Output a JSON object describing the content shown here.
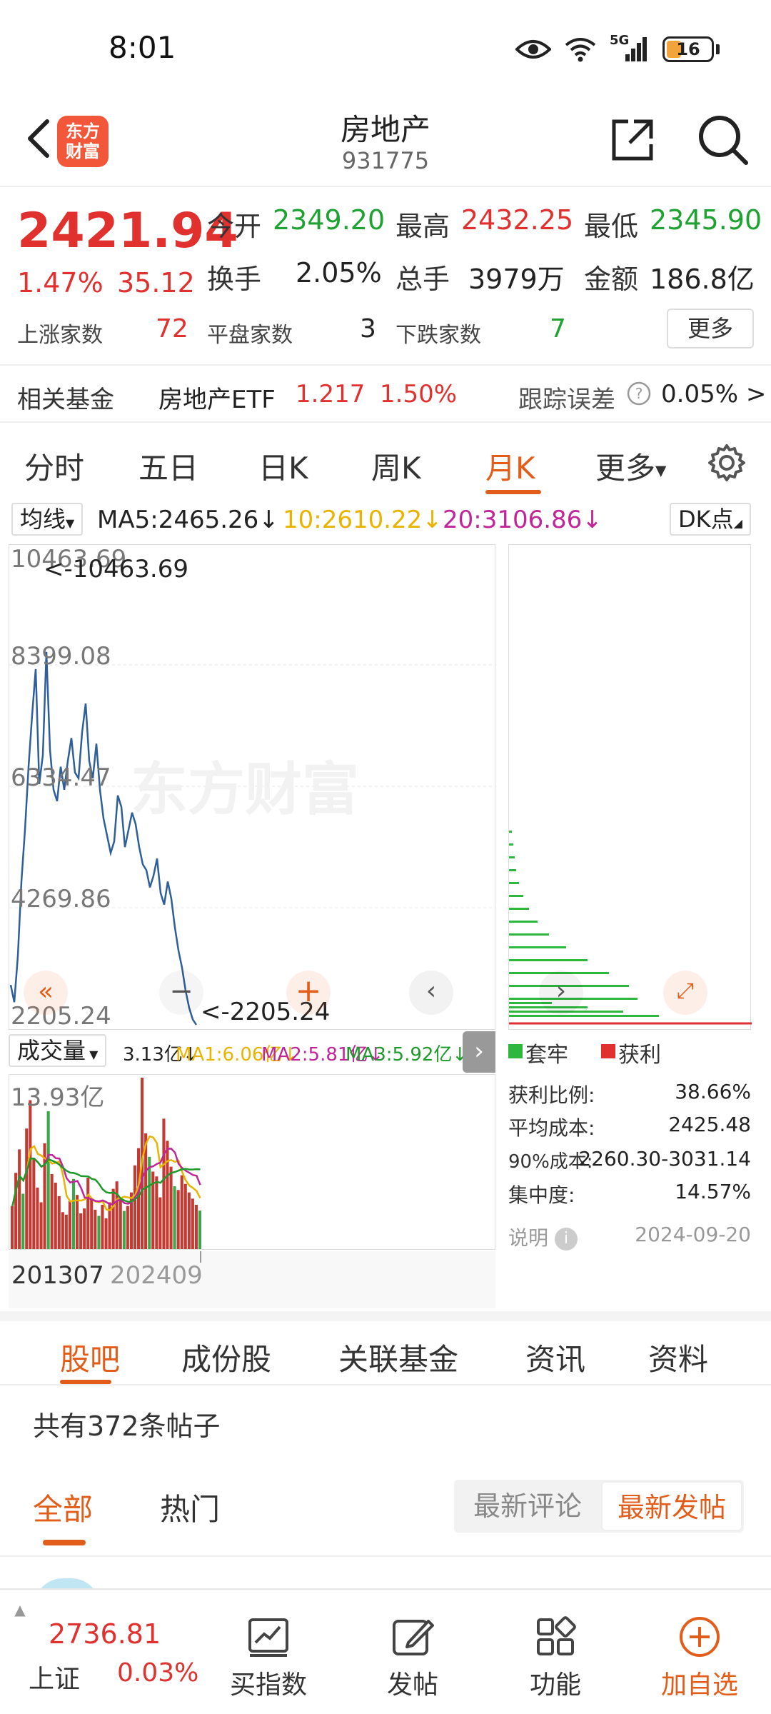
{
  "status_bar": {
    "time": "8:01",
    "network": "5G",
    "battery": "16"
  },
  "header": {
    "title": "房地产",
    "code": "931775",
    "logo_text": [
      "东方",
      "财富"
    ]
  },
  "quote": {
    "price": "2421.94",
    "change_pct": "1.47%",
    "change_val": "35.12",
    "open_label": "今开",
    "open": "2349.20",
    "high_label": "最高",
    "high": "2432.25",
    "low_label": "最低",
    "low": "2345.90",
    "turnover_label": "换手",
    "turnover": "2.05%",
    "volume_label": "总手",
    "volume": "3979万",
    "amount_label": "金额",
    "amount": "186.8亿",
    "up_label": "上涨家数",
    "up": "72",
    "flat_label": "平盘家数",
    "flat": "3",
    "down_label": "下跌家数",
    "down": "7",
    "more_label": "更多"
  },
  "fund": {
    "label": "相关基金",
    "name": "房地产ETF",
    "price": "1.217",
    "pct": "1.50%",
    "tracking_label": "跟踪误差",
    "tracking_value": "0.05% >"
  },
  "period_tabs": [
    "分时",
    "五日",
    "日K",
    "周K",
    "月K",
    "更多"
  ],
  "active_period": "月K",
  "ma": {
    "selector": "均线",
    "ma5": "MA5:2465.26↓",
    "ma10": "10:2610.22↓",
    "ma20": "20:3106.86↓",
    "dk_label": "DK点",
    "ma5_color": "#222222",
    "ma10_color": "#e8b400",
    "ma20_color": "#c0269a"
  },
  "chart": {
    "y_ticks": [
      "10463.69",
      "8399.08",
      "6334.47",
      "4269.86",
      "2205.24"
    ],
    "max_marker": "<-10463.69",
    "min_marker": "<-2205.24",
    "watermark": "东方财富",
    "line_color": "#2e5f9a",
    "monthly_close": [
      2900,
      2600,
      3400,
      4700,
      5600,
      6700,
      7600,
      8400,
      6400,
      6900,
      8700,
      7000,
      6300,
      6100,
      6700,
      6300,
      6800,
      7200,
      6600,
      6500,
      7300,
      7800,
      6800,
      6500,
      7100,
      6300,
      5800,
      5500,
      5200,
      5400,
      6200,
      6000,
      5300,
      5600,
      5900,
      5700,
      5300,
      5000,
      4900,
      4600,
      4800,
      5100,
      4500,
      4300,
      4700,
      4400,
      3900,
      3500,
      3200,
      2800,
      2500,
      2300,
      2205
    ]
  },
  "volume": {
    "selector": "成交量",
    "vol": "3.13亿↓",
    "ma1": "MA1:6.06亿↓",
    "ma2": "MA2:5.81亿↓",
    "ma3": "MA3:5.92亿↓",
    "max_label": "13.93亿",
    "ma1_color": "#e8b400",
    "ma2_color": "#c0269a",
    "ma3_color": "#1e9a2a",
    "bars": [
      3.5,
      6.2,
      8.1,
      4.5,
      9.8,
      12.1,
      7.3,
      5.0,
      3.8,
      8.6,
      11.2,
      6.1,
      5.4,
      4.3,
      3.0,
      2.8,
      3.9,
      5.7,
      4.4,
      2.9,
      3.3,
      5.8,
      4.1,
      3.2,
      2.7,
      3.6,
      2.5,
      3.8,
      4.9,
      5.5,
      4.0,
      3.1,
      3.5,
      4.6,
      6.8,
      8.2,
      13.93,
      9.4,
      7.5,
      6.3,
      5.9,
      4.2,
      10.6,
      8.8,
      6.7,
      5.1,
      4.8,
      6.0,
      5.3,
      4.6,
      4.1,
      3.6,
      3.13
    ],
    "start_date": "201307",
    "end_date": "202409"
  },
  "chips": {
    "legend_trapped": "套牢",
    "legend_profit": "获利",
    "trapped_color": "#2db83d",
    "profit_color": "#e0312f",
    "profit_ratio_label": "获利比例:",
    "profit_ratio": "38.66%",
    "avg_cost_label": "平均成本:",
    "avg_cost": "2425.48",
    "cost90_label": "90%成本:",
    "cost90": "2260.30-3031.14",
    "concentration_label": "集中度:",
    "concentration": "14.57%",
    "note_label": "说明",
    "date": "2024-09-20"
  },
  "section_tabs": [
    "股吧",
    "成份股",
    "关联基金",
    "资讯",
    "资料"
  ],
  "posts": {
    "count_text": "共有372条帖子",
    "filter_all": "全部",
    "filter_hot": "热门",
    "sort_comment": "最新评论",
    "sort_post": "最新发帖"
  },
  "bottom_nav": {
    "index_value": "2736.81",
    "index_name": "上证",
    "index_pct": "0.03%",
    "buy_index": "买指数",
    "post": "发帖",
    "functions": "功能",
    "add_watch": "加自选"
  }
}
